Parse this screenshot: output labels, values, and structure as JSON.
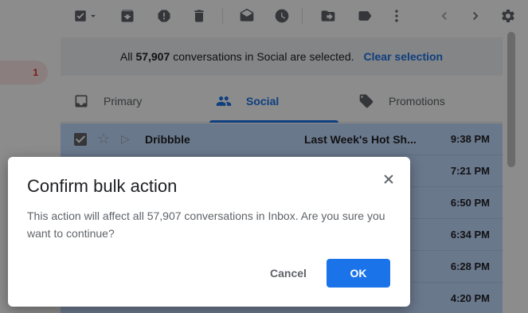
{
  "sidebar": {
    "inbox_count": "1"
  },
  "toolbar": {
    "icons": [
      "select-all-checkbox",
      "archive-icon",
      "report-spam-icon",
      "delete-icon",
      "mark-read-icon",
      "snooze-icon",
      "move-to-icon",
      "label-icon",
      "more-icon",
      "prev-icon",
      "next-icon",
      "settings-icon"
    ]
  },
  "banner": {
    "prefix": "All",
    "count": "57,907",
    "suffix": "conversations in Social are selected.",
    "clear_label": "Clear selection"
  },
  "tabs": [
    {
      "label": "Primary",
      "icon": "inbox-icon"
    },
    {
      "label": "Social",
      "icon": "people-icon",
      "active": true
    },
    {
      "label": "Promotions",
      "icon": "tag-icon"
    }
  ],
  "rows": [
    {
      "sender": "Dribbble",
      "subject": "Last Week's Hot Sh...",
      "time": "9:38 PM"
    },
    {
      "sender": "",
      "subject": "",
      "time": "7:21 PM"
    },
    {
      "sender": "",
      "subject": "",
      "time": "6:50 PM"
    },
    {
      "sender": "",
      "subject": "",
      "time": "6:34 PM"
    },
    {
      "sender": "",
      "subject": "",
      "time": "6:28 PM"
    },
    {
      "sender": "",
      "subject": "",
      "time": "4:20 PM"
    }
  ],
  "dialog": {
    "title": "Confirm bulk action",
    "body": "This action will affect all 57,907 conversations in Inbox. Are you sure you want to continue?",
    "cancel_label": "Cancel",
    "ok_label": "OK"
  },
  "colors": {
    "accent": "#1a73e8",
    "selected_row": "#c2dbff"
  }
}
